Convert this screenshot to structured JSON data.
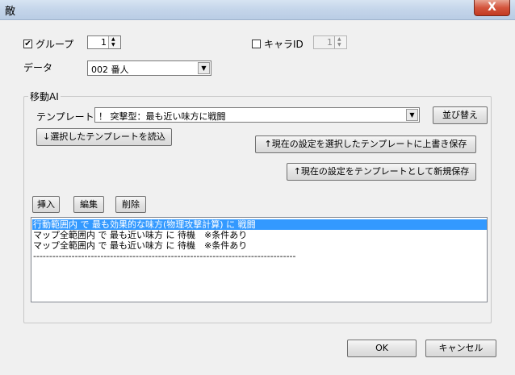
{
  "window": {
    "title": "敵",
    "close_glyph": "X"
  },
  "group_checkbox": {
    "label": "グループ",
    "checked": true,
    "check_glyph": "✔",
    "value": "1"
  },
  "chara_id": {
    "label": "キャラID",
    "checked": false,
    "value": "1"
  },
  "data_field": {
    "label": "データ",
    "selected": "002 番人"
  },
  "move_ai": {
    "label": "移動AI",
    "template_label": "テンプレート",
    "template_selected": "！ 突撃型：最も近い味方に戦闘",
    "sort_button": "並び替え",
    "load_button": "↓選択したテンプレートを読込",
    "overwrite_button": "↑現在の設定を選択したテンプレートに上書き保存",
    "save_new_button": "↑現在の設定をテンプレートとして新規保存",
    "insert_button": "挿入",
    "edit_button": "編集",
    "delete_button": "削除",
    "list_items": [
      {
        "text": "行動範囲内 で 最も効果的な味方(物理攻撃計算) に 戦闘",
        "selected": true
      },
      {
        "text": "マップ全範囲内 で 最も近い味方 に 待機　※条件あり",
        "selected": false
      },
      {
        "text": "マップ全範囲内 で 最も近い味方 に 待機　※条件あり",
        "selected": false
      },
      {
        "text": "----------------------------------------------------------------------------------",
        "selected": false
      }
    ]
  },
  "footer": {
    "ok_button": "OK",
    "cancel_button": "キャンセル"
  },
  "icons": {
    "dropdown": "▼",
    "spin_up": "▲",
    "spin_down": "▼"
  }
}
